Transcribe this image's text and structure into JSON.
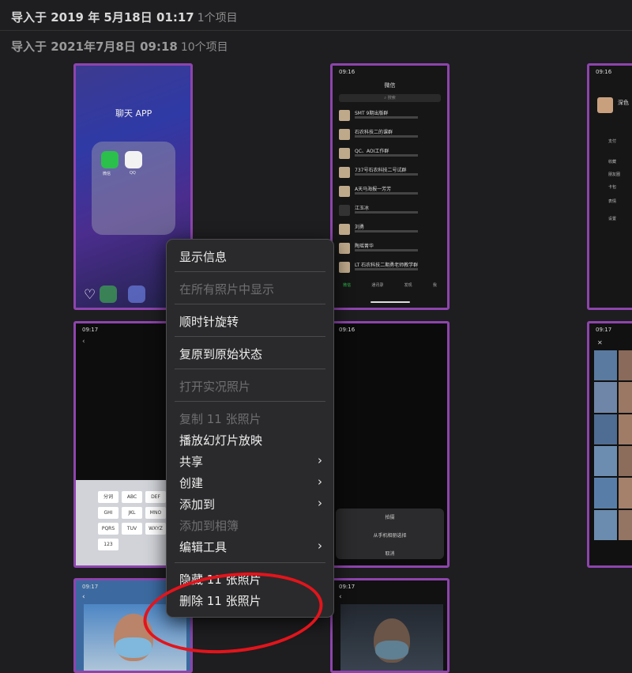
{
  "headers": [
    {
      "title": "导入于 2019 年 5月18日 01:17",
      "count": "1个项目"
    },
    {
      "title": "导入于 2021年7月8日 09:18",
      "count": "10个项目"
    }
  ],
  "thumbs": {
    "home": {
      "folder_label": "聊天 APP",
      "app1": "微信",
      "app2": "QQ"
    },
    "wechat": {
      "time": "09:16",
      "title": "微信",
      "search": "搜索",
      "chats": [
        "SMT 9期出版群",
        "石农科技二的课群",
        "QC、AOI工作群",
        "737号石农科技二号试群",
        "A天马海报一芳芳",
        "江玉冰",
        "刘勇",
        "陶瑶菁华",
        "LT 石农科技二期勇老师教学群"
      ],
      "tabs": [
        "微信",
        "通讯录",
        "发现",
        "我"
      ]
    },
    "me": {
      "time": "09:16",
      "name": "深色",
      "items": [
        "支付",
        "收藏",
        "朋友圈",
        "卡包",
        "表情",
        "设置"
      ]
    },
    "keyboard": {
      "time": "09:17",
      "keys": [
        "分词",
        "ABC",
        "DEF",
        "GHI",
        "JKL",
        "MNO",
        "PQRS",
        "TUV",
        "WXYZ",
        "123"
      ]
    },
    "sheet": {
      "time": "09:16",
      "options": [
        "拍摄",
        "从手机相册选择",
        "取消"
      ]
    },
    "faces": {
      "time": "09:17"
    },
    "selfie1": {
      "time": "09:17"
    },
    "selfie2": {
      "time": "09:17"
    }
  },
  "menu": {
    "show_info": "显示信息",
    "show_in_all": "在所有照片中显示",
    "rotate_cw": "顺时针旋转",
    "revert": "复原到原始状态",
    "open_live": "打开实况照片",
    "copy": "复制 11 张照片",
    "slideshow": "播放幻灯片放映",
    "share": "共享",
    "create": "创建",
    "add_to": "添加到",
    "add_to_album": "添加到相簿",
    "edit_tools": "编辑工具",
    "hide": "隐藏 11 张照片",
    "delete": "删除 11 张照片",
    "chevron": "›"
  },
  "colors": {
    "selection": "#8e44ad",
    "annotation": "#e3141b",
    "background": "#1e1d20"
  }
}
